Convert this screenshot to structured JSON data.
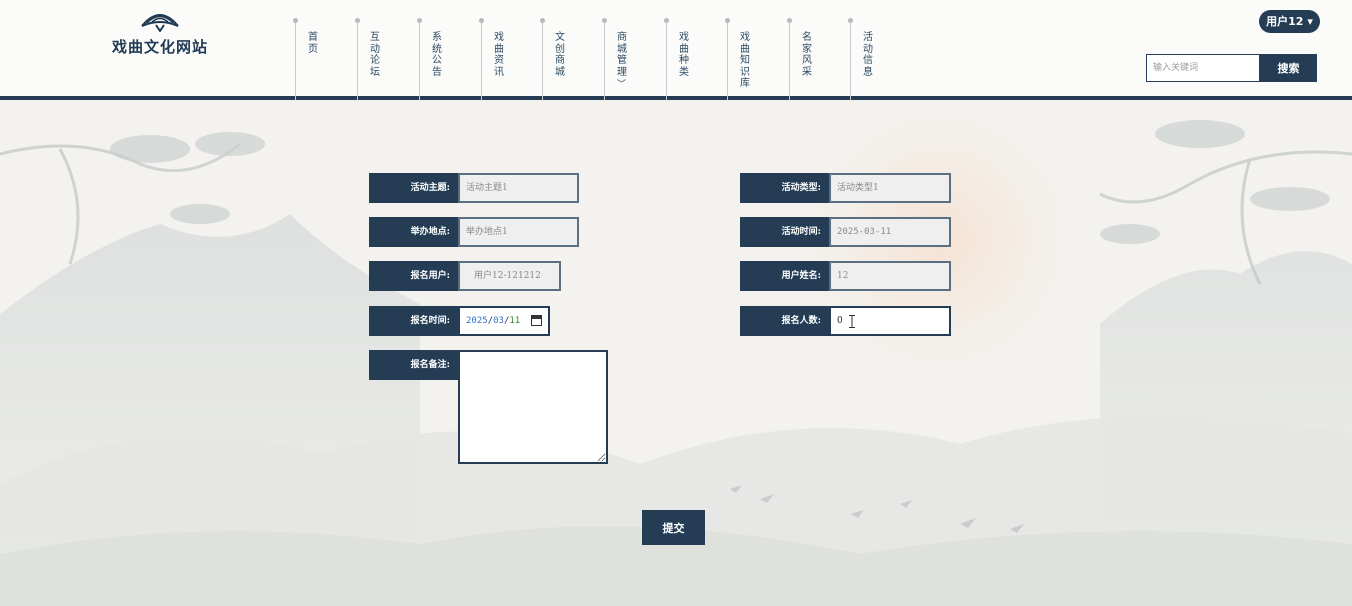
{
  "site": {
    "title": "戏曲文化网站"
  },
  "nav": {
    "items": [
      {
        "label": "首页"
      },
      {
        "label": "互动论坛"
      },
      {
        "label": "系统公告"
      },
      {
        "label": "戏曲资讯"
      },
      {
        "label": "文创商城"
      },
      {
        "label": "商城管理",
        "has_dropdown": true
      },
      {
        "label": "戏曲种类"
      },
      {
        "label": "戏曲知识库"
      },
      {
        "label": "名家风采"
      },
      {
        "label": "活动信息"
      }
    ]
  },
  "user": {
    "name": "用户12",
    "caret": "▾"
  },
  "search": {
    "placeholder": "输入关键词",
    "button": "搜索"
  },
  "form": {
    "activity_theme": {
      "label": "活动主题:",
      "value": "活动主题1"
    },
    "venue": {
      "label": "举办地点:",
      "value": "举办地点1"
    },
    "signup_user": {
      "label": "报名用户:",
      "value": "用户12-121212"
    },
    "signup_time": {
      "label": "报名时间:",
      "year": "2025",
      "month": "03",
      "day": "11"
    },
    "note": {
      "label": "报名备注:",
      "value": ""
    },
    "activity_type": {
      "label": "活动类型:",
      "value": "活动类型1"
    },
    "activity_time": {
      "label": "活动时间:",
      "value": "2025-03-11"
    },
    "user_name": {
      "label": "用户姓名:",
      "value": "12"
    },
    "signup_count": {
      "label": "报名人数:",
      "value": "0"
    },
    "submit": "提交"
  },
  "colors": {
    "primary": "#243d55",
    "background": "#f3f2ee",
    "header_bg": "#fbfbf9"
  }
}
